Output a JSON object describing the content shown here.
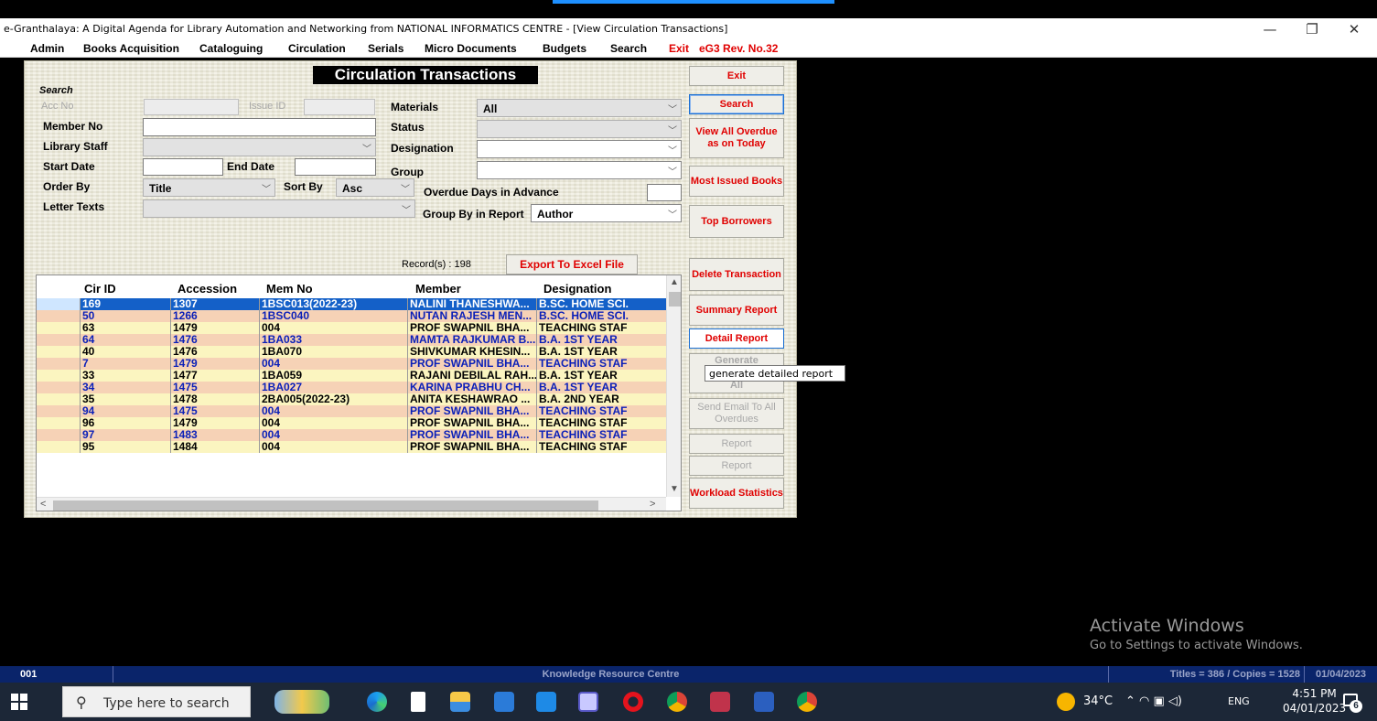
{
  "window": {
    "title": "e-Granthalaya: A Digital Agenda for Library Automation and Networking from NATIONAL INFORMATICS CENTRE - [View Circulation Transactions]",
    "minimize_glyph": "—",
    "restore_glyph": "❐",
    "close_glyph": "✕"
  },
  "menu": [
    "Admin",
    "Books Acquisition",
    "Cataloguing",
    "Circulation",
    "Serials",
    "Micro Documents",
    "Budgets",
    "Search",
    "Exit",
    "eG3 Rev. No.32"
  ],
  "form": {
    "heading": "Circulation Transactions",
    "search_label": "Search",
    "acc_no_label": "Acc No",
    "issue_id_label": "Issue ID",
    "member_no_label": "Member No",
    "library_staff_label": "Library Staff",
    "start_date_label": "Start Date",
    "end_date_label": "End Date",
    "order_by_label": "Order By",
    "order_by_value": "Title",
    "sort_by_label": "Sort By",
    "sort_by_value": "Asc",
    "letter_texts_label": "Letter Texts",
    "materials_label": "Materials",
    "materials_value": "All",
    "status_label": "Status",
    "designation_label": "Designation",
    "group_label": "Group",
    "overdue_days_label": "Overdue Days in Advance",
    "group_by_report_label": "Group By in Report",
    "group_by_report_value": "Author"
  },
  "buttons": {
    "exit": "Exit",
    "search": "Search",
    "view_all_overdue": "View All Overdue as on Today",
    "most_issued": "Most Issued Books",
    "top_borrowers": "Top Borrowers",
    "delete_transaction": "Delete Transaction",
    "summary_report": "Summary Report",
    "detail_report": "Detail Report",
    "generate": "Generate R... All",
    "generate_top": "Generate",
    "generate_bottom": "All",
    "send_email": "Send Email To All Overdues",
    "report1": "Report",
    "report2": "Report",
    "workload": "Workload Statistics",
    "export": "Export To Excel File"
  },
  "tooltip": "generate detailed report",
  "records_text": "Record(s) : 198",
  "grid": {
    "columns": [
      "Cir ID",
      "Accession",
      "Mem No",
      "Member",
      "Designation"
    ],
    "rows": [
      {
        "cells": [
          "169",
          "1307",
          "1BSC013(2022-23)",
          "NALINI THANESHWA...",
          "B.SC. HOME SCI."
        ],
        "style": "selected"
      },
      {
        "cells": [
          "50",
          "1266",
          "1BSC040",
          "NUTAN RAJESH MEN...",
          "B.SC. HOME SCI."
        ],
        "style": "peach-blue"
      },
      {
        "cells": [
          "63",
          "1479",
          "004",
          "PROF SWAPNIL BHA...",
          "TEACHING STAF"
        ],
        "style": "yellow"
      },
      {
        "cells": [
          "64",
          "1476",
          "1BA033",
          "MAMTA RAJKUMAR B...",
          "B.A. 1ST YEAR"
        ],
        "style": "peach-blue"
      },
      {
        "cells": [
          "40",
          "1476",
          "1BA070",
          "SHIVKUMAR KHESIN...",
          "B.A. 1ST YEAR"
        ],
        "style": "yellow"
      },
      {
        "cells": [
          "7",
          "1479",
          "004",
          "PROF SWAPNIL BHA...",
          "TEACHING STAF"
        ],
        "style": "peach-blue"
      },
      {
        "cells": [
          "33",
          "1477",
          "1BA059",
          "RAJANI DEBILAL RAH...",
          "B.A. 1ST YEAR"
        ],
        "style": "yellow"
      },
      {
        "cells": [
          "34",
          "1475",
          "1BA027",
          "KARINA PRABHU CH...",
          "B.A. 1ST YEAR"
        ],
        "style": "peach-blue"
      },
      {
        "cells": [
          "35",
          "1478",
          "2BA005(2022-23)",
          "ANITA KESHAWRAO ...",
          "B.A. 2ND YEAR"
        ],
        "style": "yellow"
      },
      {
        "cells": [
          "94",
          "1475",
          "004",
          "PROF SWAPNIL BHA...",
          "TEACHING STAF"
        ],
        "style": "peach-blue"
      },
      {
        "cells": [
          "96",
          "1479",
          "004",
          "PROF SWAPNIL BHA...",
          "TEACHING STAF"
        ],
        "style": "yellow"
      },
      {
        "cells": [
          "97",
          "1483",
          "004",
          "PROF SWAPNIL BHA...",
          "TEACHING STAF"
        ],
        "style": "peach-blue"
      },
      {
        "cells": [
          "95",
          "1484",
          "004",
          "PROF SWAPNIL BHA...",
          "TEACHING STAF"
        ],
        "style": "yellow"
      }
    ]
  },
  "watermark": {
    "line1": "Activate Windows",
    "line2": "Go to Settings to activate Windows."
  },
  "statusbar": {
    "code": "001",
    "centre": "Knowledge Resource Centre",
    "titles": "Titles = 386 / Copies = 1528",
    "date": "01/04/2023"
  },
  "taskbar": {
    "search_placeholder": "Type here to search",
    "temperature": "34°C",
    "language": "ENG",
    "time": "4:51 PM",
    "date": "04/01/2023",
    "notifications": "6",
    "apps": [
      "weather-icon",
      "edge-icon",
      "notepad-icon",
      "file-explorer-icon",
      "store-icon",
      "mail-icon",
      "egranthalaya-icon",
      "opera-icon",
      "chrome-icon",
      "access-icon",
      "word-icon",
      "chrome-profile-icon"
    ]
  },
  "colors": {
    "selected_row": "#1460c8",
    "peach_row": "#f6d2b6",
    "yellow_row": "#fbf5c0",
    "row_blue_text": "#0a1fb8",
    "button_red": "#e00000",
    "statusbar": "#0a246a",
    "taskbar": "#1c2737"
  }
}
